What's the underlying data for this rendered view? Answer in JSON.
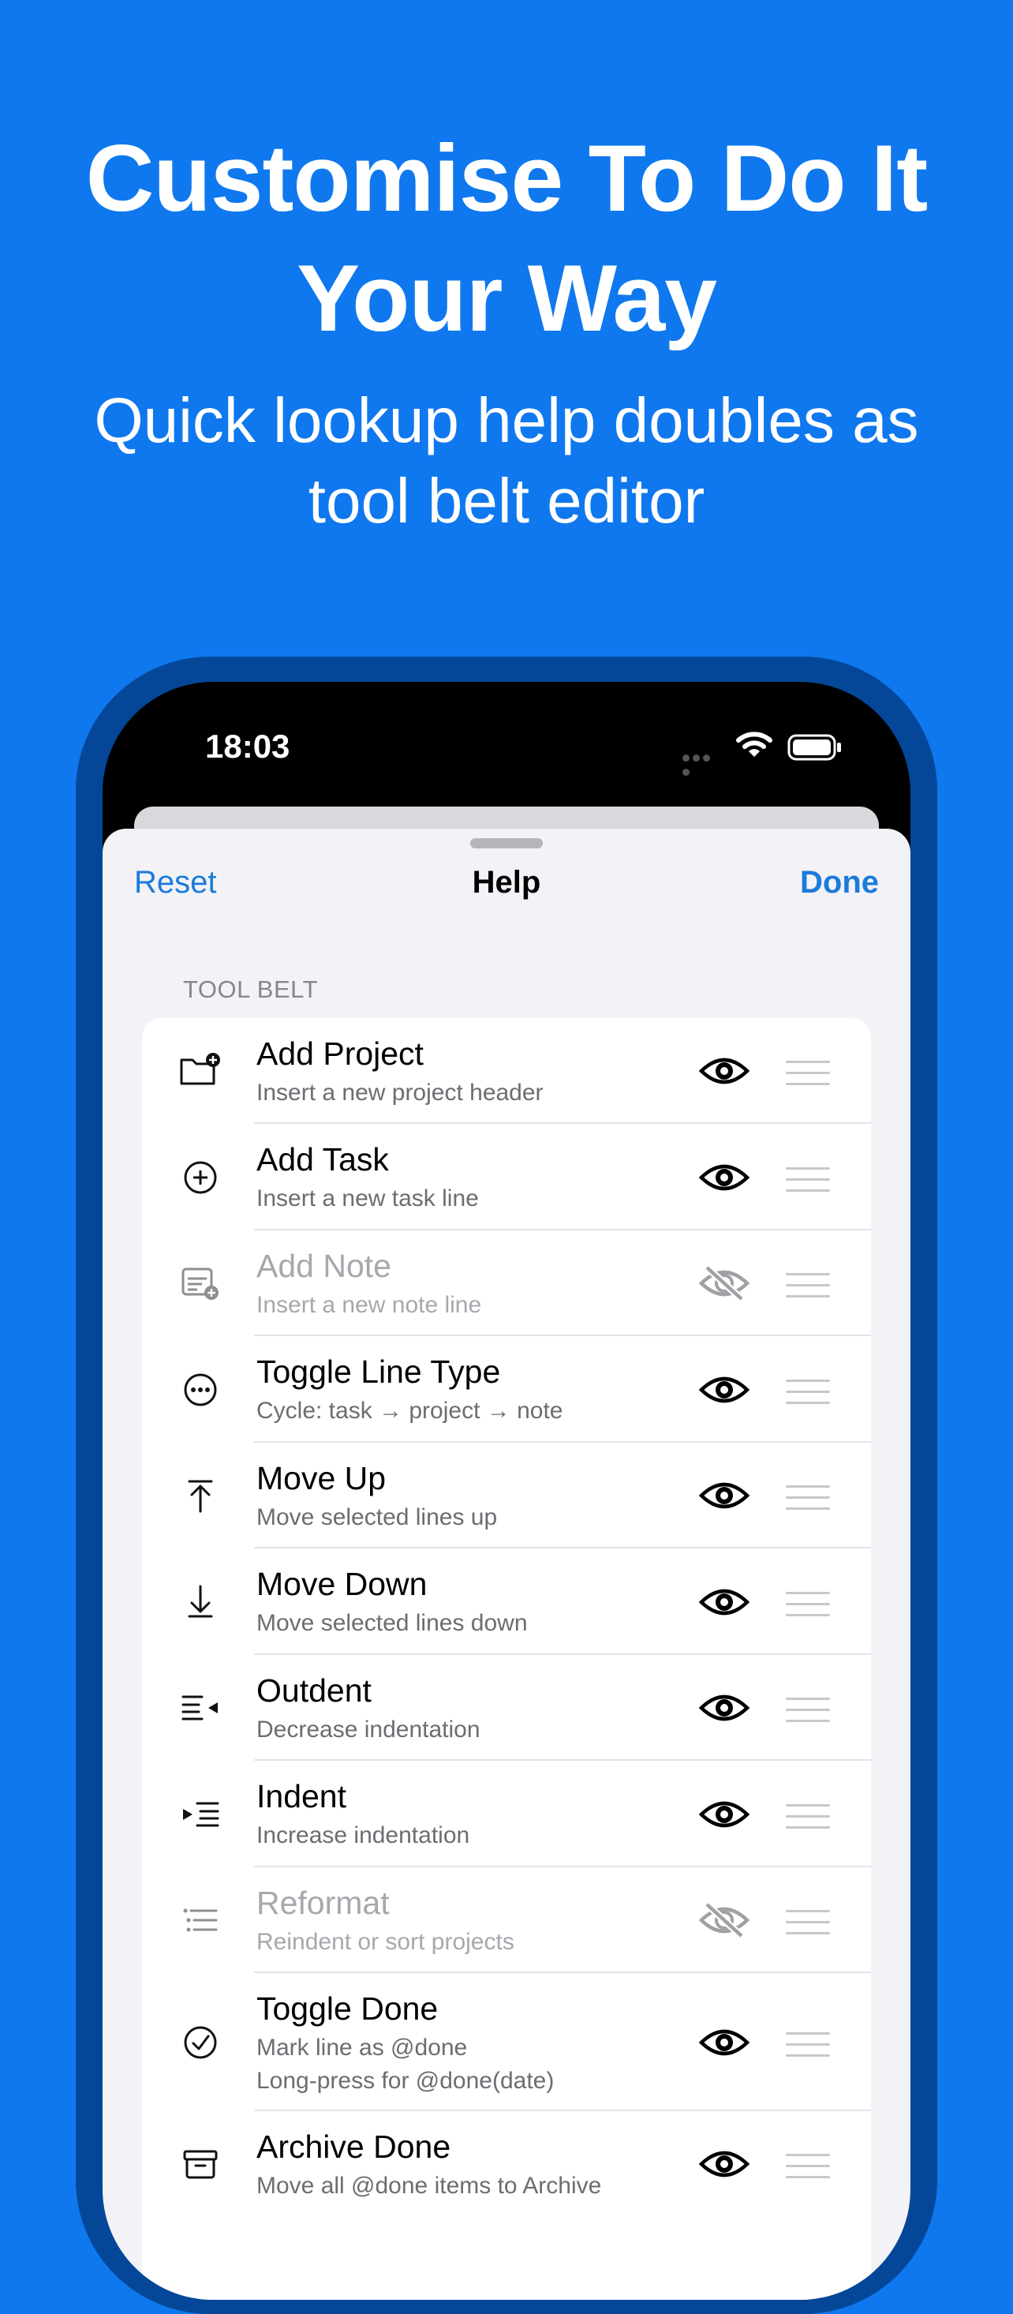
{
  "hero": {
    "title_line1": "Customise To Do It",
    "title_line2": "Your Way",
    "subtitle_line1": "Quick lookup help doubles as",
    "subtitle_line2": "tool belt editor"
  },
  "status_bar": {
    "time": "18:03"
  },
  "nav": {
    "left": "Reset",
    "title": "Help",
    "right": "Done"
  },
  "section": {
    "header": "TOOL BELT"
  },
  "rows": [
    {
      "title": "Add Project",
      "subtitle": "Insert a new project header",
      "icon": "folder-plus-icon",
      "visible": true
    },
    {
      "title": "Add Task",
      "subtitle": "Insert a new task line",
      "icon": "plus-circle-icon",
      "visible": true
    },
    {
      "title": "Add Note",
      "subtitle": "Insert a new note line",
      "icon": "note-plus-icon",
      "visible": false
    },
    {
      "title": "Toggle Line Type",
      "subtitle": "Cycle: task → project → note",
      "icon": "ellipsis-circle-icon",
      "visible": true
    },
    {
      "title": "Move Up",
      "subtitle": "Move selected lines up",
      "icon": "arrow-up-to-line-icon",
      "visible": true
    },
    {
      "title": "Move Down",
      "subtitle": "Move selected lines down",
      "icon": "arrow-down-to-line-icon",
      "visible": true
    },
    {
      "title": "Outdent",
      "subtitle": "Decrease indentation",
      "icon": "outdent-icon",
      "visible": true
    },
    {
      "title": "Indent",
      "subtitle": "Increase indentation",
      "icon": "indent-icon",
      "visible": true
    },
    {
      "title": "Reformat",
      "subtitle": "Reindent or sort projects",
      "icon": "list-icon",
      "visible": false
    },
    {
      "title": "Toggle Done",
      "subtitle": "Mark line as @done\nLong-press for @done(date)",
      "icon": "checkmark-circle-icon",
      "visible": true
    },
    {
      "title": "Archive Done",
      "subtitle": "Move all @done items to Archive",
      "icon": "archive-box-icon",
      "visible": true
    }
  ],
  "colors": {
    "background": "#0f78ee",
    "phone_frame": "#044799",
    "accent": "#1a7bd9",
    "sheet": "#f2f2f7"
  }
}
